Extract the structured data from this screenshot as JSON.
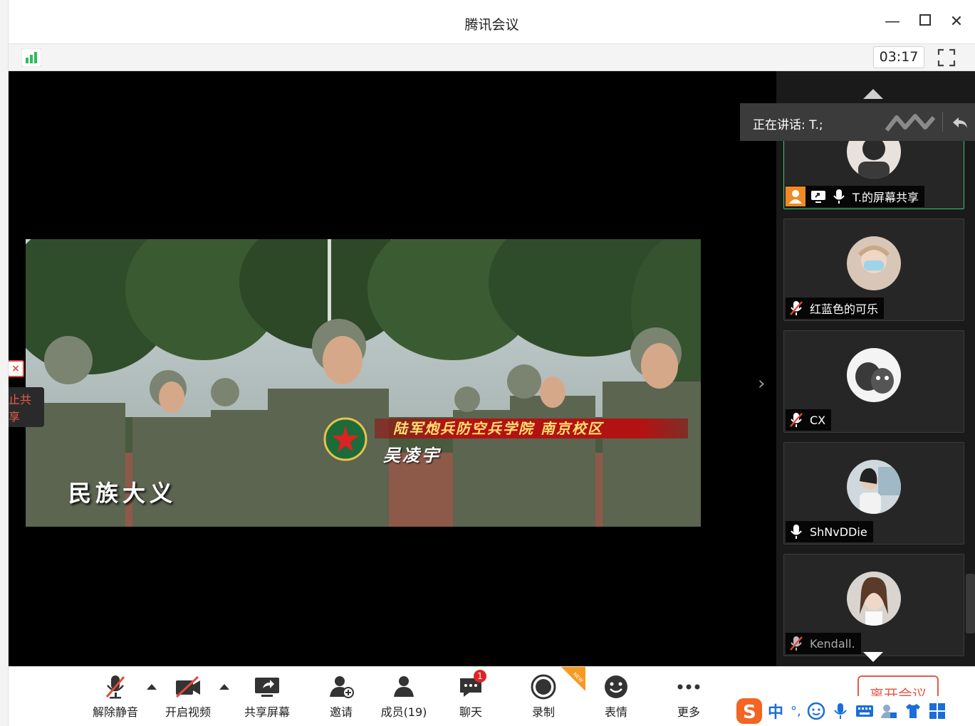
{
  "window": {
    "title": "腾讯会议",
    "minimize_glyph": "—",
    "maximize_glyph": "☐",
    "close_glyph": "✕"
  },
  "status": {
    "timer": "03:17",
    "signal_icon": "signal-strength-icon",
    "signal_color": "#2bbd5a"
  },
  "video": {
    "banner": "陆军炮兵防空兵学院 南京校区",
    "person_name": "吴凌宇",
    "caption": "民族大义"
  },
  "stage": {
    "stop_share_x": "×",
    "stop_share_label": "止共享",
    "next_arrow": "›"
  },
  "speaking": {
    "label": "正在讲话: T.;"
  },
  "participants": [
    {
      "name": "T.的屏幕共享",
      "mic": "on",
      "host": true,
      "sharing": true,
      "active": true
    },
    {
      "name": "红蓝色的可乐",
      "mic": "muted"
    },
    {
      "name": "CX",
      "mic": "muted"
    },
    {
      "name": "ShNvDDie",
      "mic": "on"
    },
    {
      "name": "Kendall.",
      "mic": "muted",
      "dim": true
    }
  ],
  "toolbar": {
    "unmute": "解除静音",
    "start_video": "开启视频",
    "share_screen": "共享屏幕",
    "invite": "邀请",
    "members": "成员(19)",
    "chat": "聊天",
    "chat_badge": "1",
    "record": "录制",
    "record_tag": "NEW",
    "emoji": "表情",
    "more": "更多",
    "leave": "离开会议"
  },
  "ime": {
    "mode": "中",
    "punct": "°,"
  },
  "colors": {
    "accent_green": "#37c871",
    "danger": "#e65a4a",
    "host_orange": "#f08a24"
  }
}
